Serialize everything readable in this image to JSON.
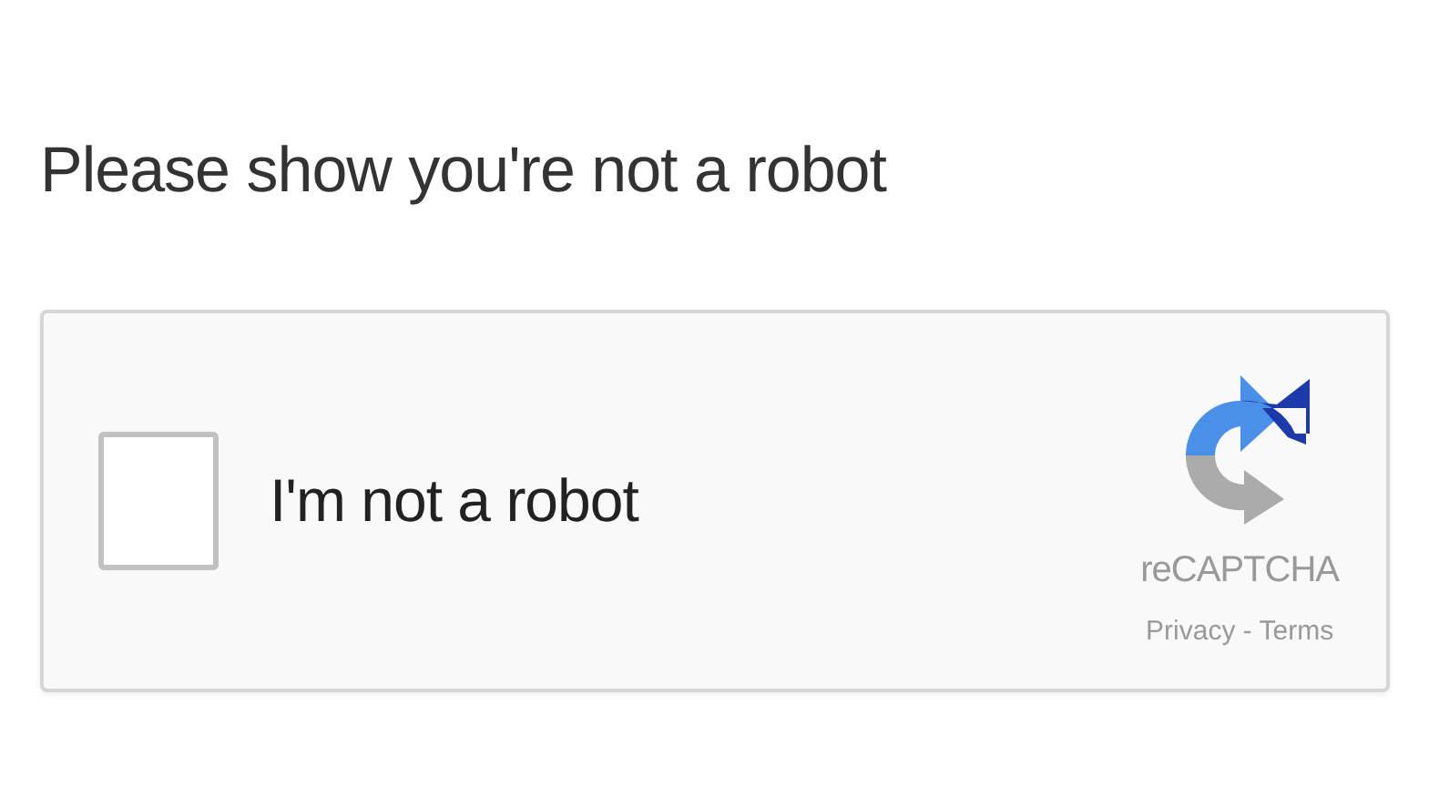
{
  "heading": "Please show you're not a robot",
  "captcha": {
    "checkbox": {
      "label": "I'm not a robot",
      "checked": false
    },
    "brand": "reCAPTCHA",
    "links": [
      "Privacy",
      "Terms"
    ],
    "separator": "-"
  }
}
